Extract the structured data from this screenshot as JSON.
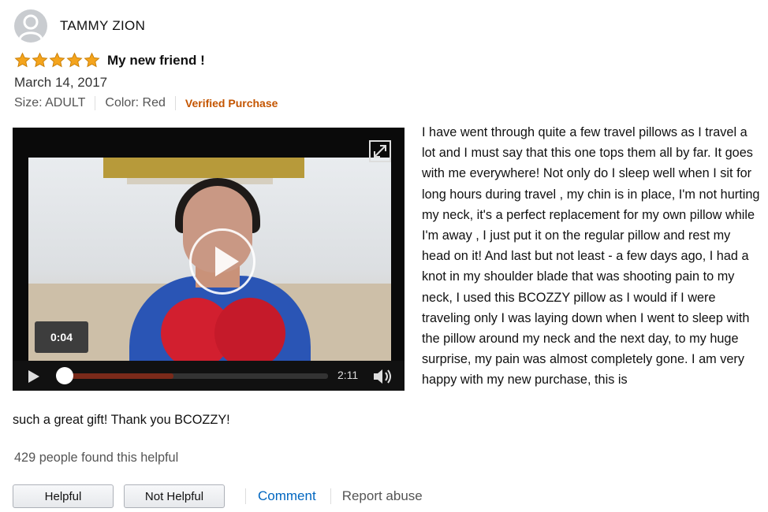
{
  "reviewer": {
    "name": "TAMMY ZION"
  },
  "review": {
    "rating": 5,
    "title": "My new friend !",
    "date": "March 14, 2017",
    "size": "Size: ADULT",
    "color": "Color: Red",
    "verified": "Verified Purchase",
    "body_main": "I have went through quite a few travel pillows as I travel a lot and I must say that this one tops them all by far. It goes with me everywhere! Not only do I sleep well when I sit for long hours during travel , my chin is in place, I'm not hurting my neck, it's a perfect replacement for my own pillow while I'm away , I just put it on the regular pillow and rest my head on it! And last but not least - a few days ago, I had a knot in my shoulder blade that was shooting pain to my neck, I used this BCOZZY pillow as I would if I were traveling only I was laying down when I went to sleep with the pillow around my neck and the next day, to my huge surprise, my pain was almost completely gone. I am very happy with my new purchase, this is",
    "body_tail": "such a great gift! Thank you BCOZZY!"
  },
  "video": {
    "current_time": "0:04",
    "duration": "2:11",
    "progress_fraction": 0.03,
    "buffered_fraction": 0.43
  },
  "helpful_count": "429 people found this helpful",
  "actions": {
    "helpful": "Helpful",
    "not_helpful": "Not Helpful",
    "comment": "Comment",
    "report": "Report abuse"
  },
  "colors": {
    "star": "#f4a41d",
    "verified": "#c45500",
    "link": "#0066c0"
  },
  "icons": [
    "avatar-person-icon",
    "star-icon",
    "expand-icon",
    "play-icon",
    "volume-icon"
  ]
}
